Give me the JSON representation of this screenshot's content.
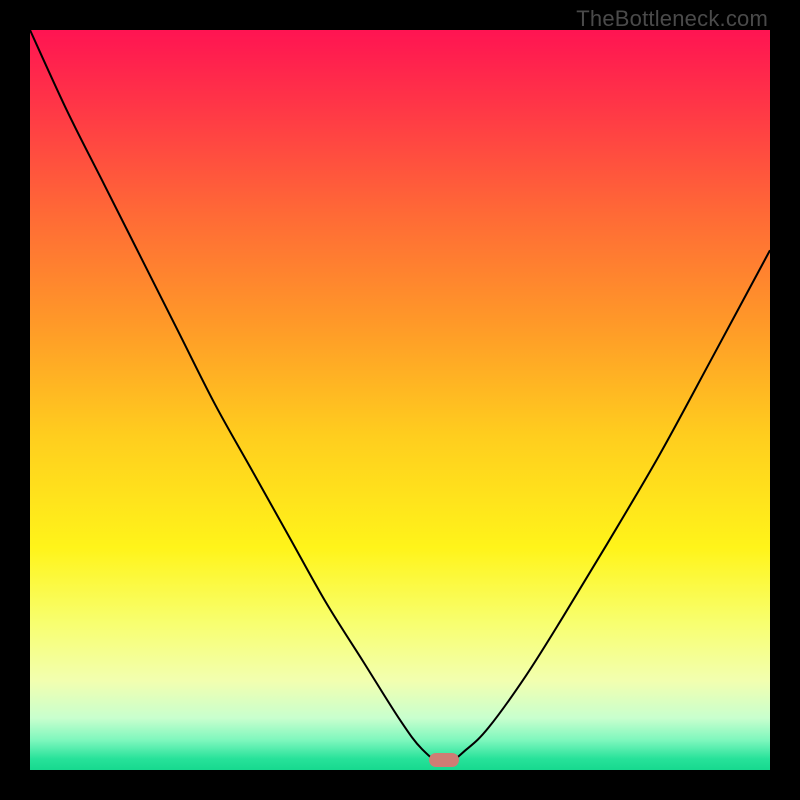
{
  "watermark": "TheBottleneck.com",
  "colors": {
    "page_bg": "#000000",
    "curve_stroke": "#000000",
    "marker_fill": "#cf7d74",
    "gradient_stops": [
      {
        "offset": 0.0,
        "color": "#ff1452"
      },
      {
        "offset": 0.1,
        "color": "#ff3547"
      },
      {
        "offset": 0.25,
        "color": "#ff6a36"
      },
      {
        "offset": 0.4,
        "color": "#ff9a28"
      },
      {
        "offset": 0.55,
        "color": "#ffce1e"
      },
      {
        "offset": 0.7,
        "color": "#fff41a"
      },
      {
        "offset": 0.8,
        "color": "#f8ff6e"
      },
      {
        "offset": 0.88,
        "color": "#f2ffb0"
      },
      {
        "offset": 0.93,
        "color": "#c8ffce"
      },
      {
        "offset": 0.96,
        "color": "#7df7bd"
      },
      {
        "offset": 0.985,
        "color": "#27e29a"
      },
      {
        "offset": 1.0,
        "color": "#17d98f"
      }
    ]
  },
  "chart_data": {
    "type": "line",
    "title": "",
    "xlabel": "",
    "ylabel": "",
    "xlim": [
      0,
      1
    ],
    "ylim": [
      0,
      1
    ],
    "note": "Bottleneck V-curve on thermal gradient heatmap. Minimum (green) near x≈0.56. x/y are normalized fractions of the plot area; y is bottleneck severity (0=optimal, 1=severe).",
    "series": [
      {
        "name": "bottleneck-curve",
        "x": [
          0.0,
          0.05,
          0.1,
          0.15,
          0.2,
          0.25,
          0.3,
          0.35,
          0.4,
          0.45,
          0.5,
          0.53,
          0.56,
          0.59,
          0.62,
          0.67,
          0.72,
          0.78,
          0.85,
          0.92,
          1.0
        ],
        "y": [
          1.0,
          0.89,
          0.79,
          0.69,
          0.59,
          0.49,
          0.4,
          0.31,
          0.22,
          0.14,
          0.06,
          0.02,
          0.0,
          0.02,
          0.05,
          0.12,
          0.2,
          0.3,
          0.42,
          0.55,
          0.7
        ]
      }
    ],
    "marker": {
      "x": 0.56,
      "y": 0.005,
      "label": "optimal-point"
    }
  }
}
